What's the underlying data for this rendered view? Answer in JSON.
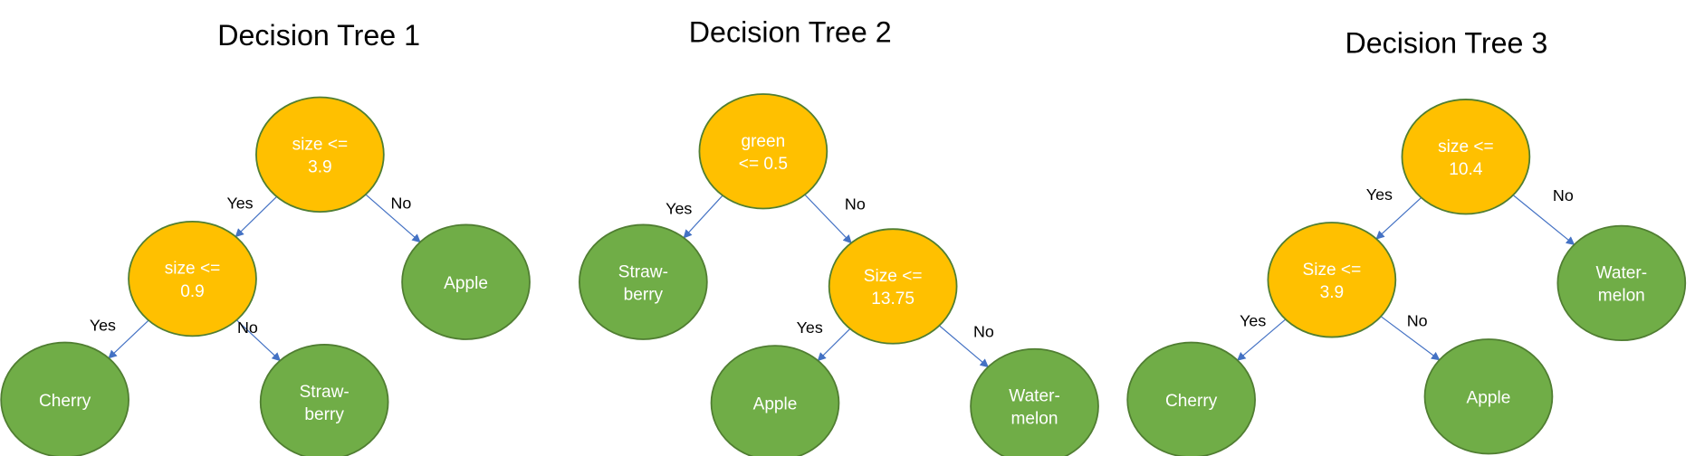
{
  "colors": {
    "decision_node": "#FFC000",
    "leaf_node": "#70AD47",
    "node_outline": "#507E32",
    "edge": "#4472C4",
    "text_on_node": "#FFFFFF"
  },
  "trees": [
    {
      "title": "Decision Tree 1",
      "nodes": [
        {
          "id": "n1",
          "type": "decision",
          "lines": [
            "size <=",
            "3.9"
          ]
        },
        {
          "id": "n2",
          "type": "decision",
          "lines": [
            "size <=",
            "0.9"
          ]
        },
        {
          "id": "n3",
          "type": "leaf",
          "lines": [
            "Apple"
          ]
        },
        {
          "id": "n4",
          "type": "leaf",
          "lines": [
            "Cherry"
          ]
        },
        {
          "id": "n5",
          "type": "leaf",
          "lines": [
            "Straw-",
            "berry"
          ]
        }
      ],
      "edges": [
        {
          "from": "n1",
          "to": "n2",
          "label": "Yes"
        },
        {
          "from": "n1",
          "to": "n3",
          "label": "No"
        },
        {
          "from": "n2",
          "to": "n4",
          "label": "Yes"
        },
        {
          "from": "n2",
          "to": "n5",
          "label": "No"
        }
      ]
    },
    {
      "title": "Decision Tree 2",
      "nodes": [
        {
          "id": "n1",
          "type": "decision",
          "lines": [
            "green",
            "<= 0.5"
          ]
        },
        {
          "id": "n2",
          "type": "leaf",
          "lines": [
            "Straw-",
            "berry"
          ]
        },
        {
          "id": "n3",
          "type": "decision",
          "lines": [
            "Size <=",
            "13.75"
          ]
        },
        {
          "id": "n4",
          "type": "leaf",
          "lines": [
            "Apple"
          ]
        },
        {
          "id": "n5",
          "type": "leaf",
          "lines": [
            "Water-",
            "melon"
          ]
        }
      ],
      "edges": [
        {
          "from": "n1",
          "to": "n2",
          "label": "Yes"
        },
        {
          "from": "n1",
          "to": "n3",
          "label": "No"
        },
        {
          "from": "n3",
          "to": "n4",
          "label": "Yes"
        },
        {
          "from": "n3",
          "to": "n5",
          "label": "No"
        }
      ]
    },
    {
      "title": "Decision Tree 3",
      "nodes": [
        {
          "id": "n1",
          "type": "decision",
          "lines": [
            "size <=",
            "10.4"
          ]
        },
        {
          "id": "n2",
          "type": "decision",
          "lines": [
            "Size <=",
            "3.9"
          ]
        },
        {
          "id": "n3",
          "type": "leaf",
          "lines": [
            "Water-",
            "melon"
          ]
        },
        {
          "id": "n4",
          "type": "leaf",
          "lines": [
            "Cherry"
          ]
        },
        {
          "id": "n5",
          "type": "leaf",
          "lines": [
            "Apple"
          ]
        }
      ],
      "edges": [
        {
          "from": "n1",
          "to": "n2",
          "label": "Yes"
        },
        {
          "from": "n1",
          "to": "n3",
          "label": "No"
        },
        {
          "from": "n2",
          "to": "n4",
          "label": "Yes"
        },
        {
          "from": "n2",
          "to": "n5",
          "label": "No"
        }
      ]
    }
  ]
}
